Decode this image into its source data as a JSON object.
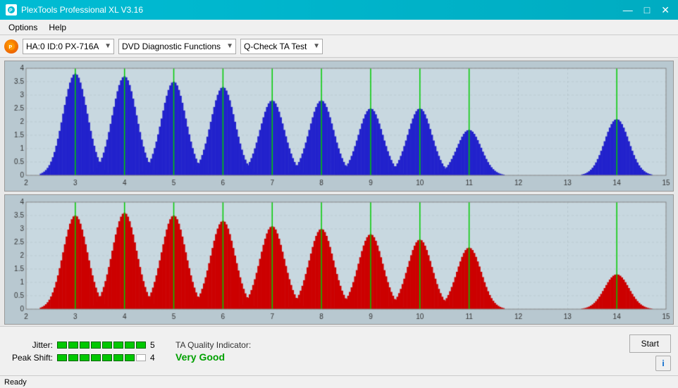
{
  "titleBar": {
    "title": "PlexTools Professional XL V3.16",
    "minBtn": "—",
    "maxBtn": "□",
    "closeBtn": "✕"
  },
  "menuBar": {
    "items": [
      "Options",
      "Help"
    ]
  },
  "toolbar": {
    "device": "HA:0 ID:0 PX-716A",
    "function": "DVD Diagnostic Functions",
    "test": "Q-Check TA Test"
  },
  "bottomPanel": {
    "jitterLabel": "Jitter:",
    "jitterSegments": 8,
    "jitterEmptySegments": 0,
    "jitterValue": "5",
    "peakShiftLabel": "Peak Shift:",
    "peakShiftSegments": 7,
    "peakShiftEmptySegments": 1,
    "peakShiftValue": "4",
    "taQualityLabel": "TA Quality Indicator:",
    "taQualityValue": "Very Good",
    "startButton": "Start"
  },
  "statusBar": {
    "text": "Ready"
  },
  "charts": {
    "topChart": {
      "color": "#0000cc",
      "peakColor": "#00cc00",
      "yMax": 4,
      "xMin": 2,
      "xMax": 15
    },
    "bottomChart": {
      "color": "#cc0000",
      "peakColor": "#00cc00",
      "yMax": 4,
      "xMin": 2,
      "xMax": 15
    }
  }
}
